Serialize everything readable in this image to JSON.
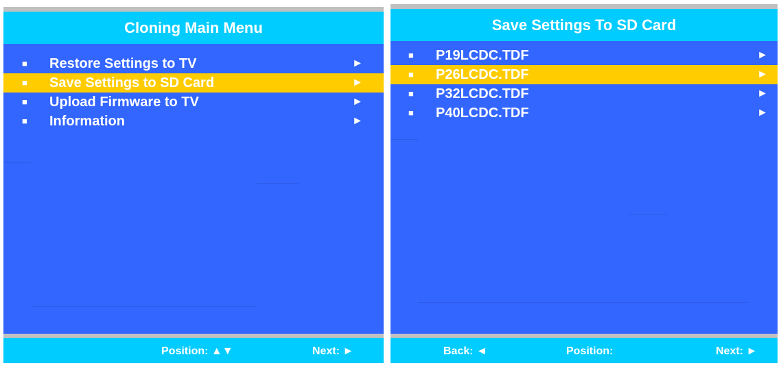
{
  "left_panel": {
    "title": "Cloning Main Menu",
    "items": [
      {
        "label": "Restore Settings to TV",
        "bullet": "■",
        "arrow": "►",
        "selected": false
      },
      {
        "label": "Save Settings to SD Card",
        "bullet": "■",
        "arrow": "►",
        "selected": true
      },
      {
        "label": "Upload Firmware to TV",
        "bullet": "■",
        "arrow": "►",
        "selected": false
      },
      {
        "label": "Information",
        "bullet": "■",
        "arrow": "►",
        "selected": false
      }
    ],
    "footer": {
      "position_label": "Position: ▲▼",
      "next_label": "Next: ►"
    }
  },
  "right_panel": {
    "title": "Save Settings To SD Card",
    "items": [
      {
        "label": "P19LCDC.TDF",
        "bullet": "■",
        "arrow": "►",
        "selected": false
      },
      {
        "label": "P26LCDC.TDF",
        "bullet": "■",
        "arrow": "►",
        "selected": true
      },
      {
        "label": "P32LCDC.TDF",
        "bullet": "■",
        "arrow": "►",
        "selected": false
      },
      {
        "label": "P40LCDC.TDF",
        "bullet": "■",
        "arrow": "►",
        "selected": false
      }
    ],
    "footer": {
      "back_label": "Back: ◄",
      "position_label": "Position:",
      "next_label": "Next: ►"
    }
  },
  "colors": {
    "panel_bg": "#3366ff",
    "header_bg": "#00ccff",
    "highlight": "#ffcc00",
    "separator": "#c0c0c0"
  }
}
